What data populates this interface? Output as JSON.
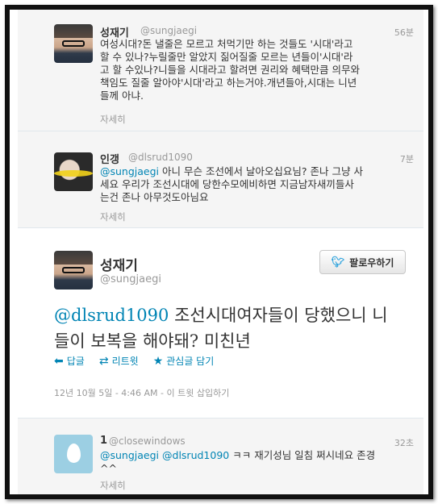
{
  "tweets": {
    "t1": {
      "name": "성재기",
      "handle": "@sungjaegi",
      "time": "56분",
      "lines": [
        "여성시대?돈 낼줄은 모르고 처먹기만 하는 것들도 '시대'라고",
        "할 수 있나?누릴줄만 알았지 짊어질줄 모르는 년들이'시대'라",
        "고 할 수있나?니들을 시대라고 할려면 권리와 혜택만큼 의무와",
        "책임도 질줄 알아야'시대'라고 하는거야.개년들아,시대는 니년",
        "들께 아냐."
      ],
      "more": "자세히"
    },
    "t2": {
      "name": "인갱",
      "handle": "@dlsrud1090",
      "time": "7분",
      "mention": "@sungjaegi",
      "line1_rest": " 아니 무슨 조선에서 날아오십요님? 존나 그냥 사",
      "line2": "세요 우리가 조선시대에 당한수모에비하면 지금남자새끼들사",
      "line3": "는건 존나 아무것도아님요",
      "more": "자세히"
    },
    "main": {
      "name": "성재기",
      "handle": "@sungjaegi",
      "follow_label": "팔로우하기",
      "mention": "@dlsrud1090",
      "line1_rest": " 조선시대여자들이 당했으니 니",
      "line2": "들이 보복을 해야돼? 미친년",
      "reply_label": "답글",
      "retweet_label": "리트윗",
      "favorite_label": "관심글 담기",
      "timestamp": "12년 10월 5일 - 4:46 AM - 이 트윗 삽입하기"
    },
    "t3": {
      "name": "1",
      "handle": "@closewindows",
      "time": "32초",
      "mention1": "@sungjaegi",
      "mention2": "@dlsrud1090",
      "line1_rest": " ㅋㅋ 재기성님 일침 쩌시네요 존경",
      "line2": "^^",
      "more": "자세히"
    }
  },
  "icons": {
    "reply": "reply-arrow-icon",
    "retweet": "retweet-icon",
    "favorite": "star-icon",
    "follow": "twitter-bird-icon"
  },
  "colors": {
    "link": "#0084b4",
    "muted": "#999999",
    "frame": "#111111"
  }
}
